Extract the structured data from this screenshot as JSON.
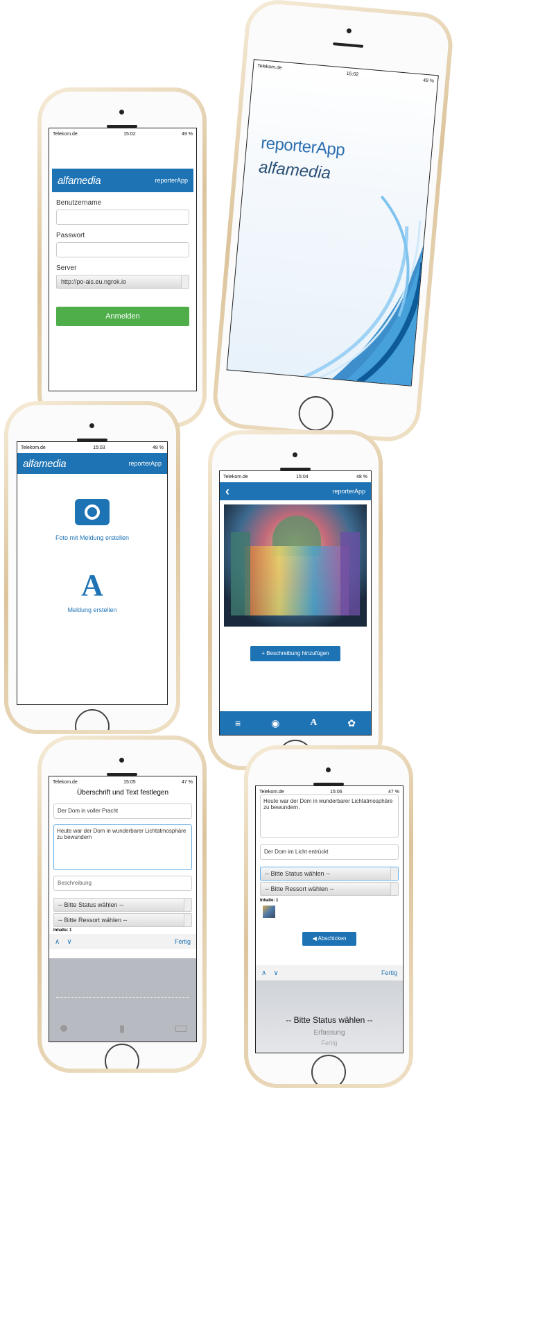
{
  "common": {
    "carrier": "Telekom.de",
    "wifi": "≈",
    "batt_icon": "▭"
  },
  "splash": {
    "time": "15:02",
    "battery": "49 %",
    "app_name": "reporterApp",
    "brand": "alfamedia"
  },
  "login": {
    "time": "15:02",
    "battery": "49 %",
    "brand": "alfamedia",
    "app_name": "reporterApp",
    "username_label": "Benutzername",
    "username_value": "",
    "password_label": "Passwort",
    "password_value": "",
    "server_label": "Server",
    "server_value": "http://po-ais.eu.ngrok.io",
    "submit": "Anmelden"
  },
  "menu": {
    "time": "15:03",
    "battery": "48 %",
    "brand": "alfamedia",
    "app_name": "reporterApp",
    "photo_option": "Foto mit Meldung erstellen",
    "letter_glyph": "A",
    "text_option": "Meldung erstellen"
  },
  "photo": {
    "time": "15:04",
    "battery": "48 %",
    "back": "‹",
    "app_name": "reporterApp",
    "add_desc": "+ Beschreibung hinzufügen",
    "tab_icons": [
      "list-icon",
      "camera-icon",
      "letter-icon",
      "gear-icon"
    ],
    "tab_labels": [
      "≡",
      "◉",
      "A",
      "✿"
    ]
  },
  "edit": {
    "time": "15:05",
    "battery": "47 %",
    "title": "Überschrift und Text festlegen",
    "headline": "Der Dom in voller Pracht",
    "text": "Heute war der Dom in wunderbarer Lichtatmosphäre zu bewundern",
    "desc_placeholder": "Beschreibung",
    "status_select": "-- Bitte Status wählen --",
    "ressort_select": "-- Bitte Ressort wählen --",
    "inhalte": "Inhalte: 1",
    "prev": "∧",
    "next": "∨",
    "done": "Fertig"
  },
  "submit": {
    "time": "15:06",
    "battery": "47 %",
    "text": "Heute war der Dom in wunderbarer Lichtatmosphäre zu bewundern.",
    "headline": "Der Dom im Licht entrückt",
    "status_select": "-- Bitte Status wählen --",
    "ressort_select": "-- Bitte Ressort wählen --",
    "inhalte": "Inhalte: 1",
    "send": "◀ Abschicken",
    "prev": "∧",
    "next": "∨",
    "done": "Fertig",
    "picker_options": [
      "-- Bitte Status wählen --",
      "Erfassung",
      "Fertig"
    ]
  }
}
